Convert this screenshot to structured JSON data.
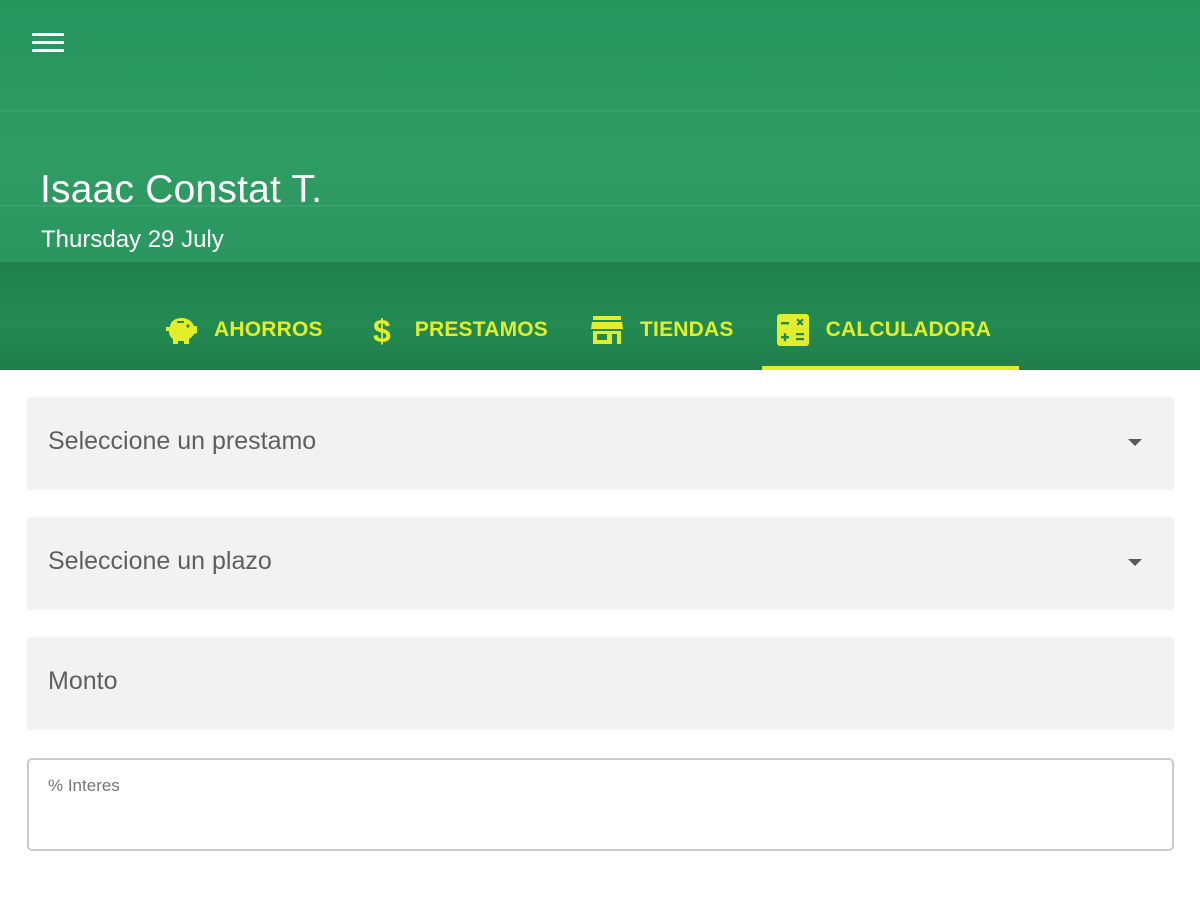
{
  "header": {
    "user_name": "Isaac Constat T.",
    "date": "Thursday 29 July",
    "background_color": "#2b9660",
    "accent_color": "#e2ee2a"
  },
  "menu": {
    "icon": "hamburger-menu-icon"
  },
  "tabs": [
    {
      "label": "AHORROS",
      "icon": "piggy-bank-icon",
      "active": false
    },
    {
      "label": "PRESTAMOS",
      "icon": "dollar-icon",
      "active": false
    },
    {
      "label": "TIENDAS",
      "icon": "store-icon",
      "active": false
    },
    {
      "label": "CALCULADORA",
      "icon": "calculator-icon",
      "active": true
    }
  ],
  "form": {
    "loan_select": {
      "label": "Seleccione un prestamo",
      "icon": "dropdown-arrow-icon"
    },
    "term_select": {
      "label": "Seleccione un plazo",
      "icon": "dropdown-arrow-icon"
    },
    "amount": {
      "label": "Monto"
    },
    "interest": {
      "label": "% Interes",
      "value": ""
    }
  }
}
